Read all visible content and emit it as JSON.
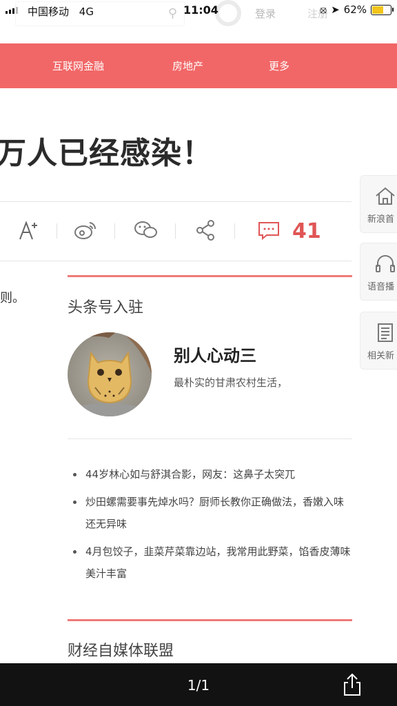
{
  "status_bar": {
    "carrier": "中国移动",
    "network": "4G",
    "time": "11:04",
    "battery": "62%",
    "battery_level": 0.62
  },
  "header": {
    "login": "登录",
    "register": "注册"
  },
  "nav": {
    "items": [
      "互联网金融",
      "房地产",
      "更多"
    ]
  },
  "article": {
    "headline_fragment": "万人已经感染！",
    "body_fragment": "则。",
    "comment_count": "41"
  },
  "side_buttons": [
    {
      "label": "新浪首",
      "icon": "home-icon"
    },
    {
      "label": "语音播",
      "icon": "headphones-icon"
    },
    {
      "label": "相关新",
      "icon": "news-icon"
    }
  ],
  "toutiao_section": {
    "title": "头条号入驻",
    "author_name": "别人心动三",
    "author_bio": "最朴实的甘肃农村生活，"
  },
  "news_list": [
    "44岁林心如与舒淇合影，网友：这鼻子太突兀",
    "炒田螺需要事先焯水吗？厨师长教你正确做法，香嫩入味还无异味",
    "4月包饺子，韭菜芹菜靠边站，我常用此野菜，馅香皮薄味美汁丰富"
  ],
  "finance_section": {
    "title": "财经自媒体联盟"
  },
  "bottom_bar": {
    "page_indicator": "1/1"
  },
  "colors": {
    "nav_red": "#f16767",
    "accent_red": "#e05555",
    "battery_yellow": "#f3c41b"
  }
}
